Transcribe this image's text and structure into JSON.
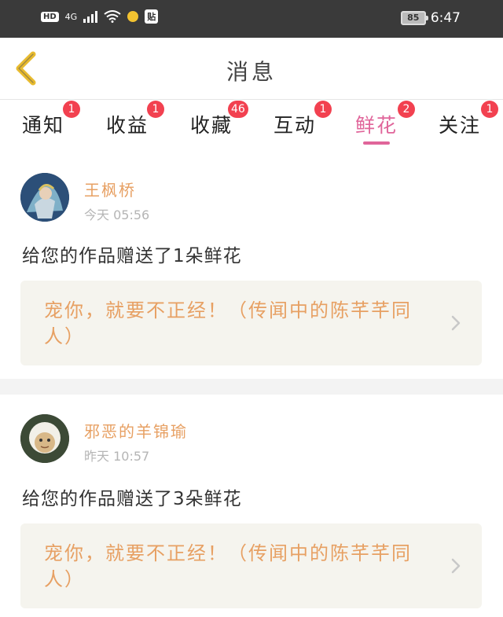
{
  "status_bar": {
    "hd": "HD",
    "network": "4G",
    "tie_label": "贴",
    "battery": "85",
    "time": "6:47"
  },
  "header": {
    "title": "消息",
    "back_icon": "chevron-left-icon",
    "back_color": "#e8bb2f"
  },
  "tabs": [
    {
      "label": "通知",
      "badge": "1",
      "active": false
    },
    {
      "label": "收益",
      "badge": "1",
      "active": false
    },
    {
      "label": "收藏",
      "badge": "46",
      "active": false
    },
    {
      "label": "互动",
      "badge": "1",
      "active": false
    },
    {
      "label": "鲜花",
      "badge": "2",
      "active": true
    },
    {
      "label": "关注",
      "badge": "1",
      "active": false
    }
  ],
  "colors": {
    "accent": "#e0659a",
    "badge": "#f24150",
    "name": "#e7a063",
    "card_bg": "#f5f4ee"
  },
  "notifications": [
    {
      "sender": "王枫桥",
      "time": "今天 05:56",
      "message": "给您的作品赠送了1朵鲜花",
      "work_title": "宠你，就要不正经！（传闻中的陈芊芊同人）"
    },
    {
      "sender": "邪恶的羊锦瑜",
      "time": "昨天 10:57",
      "message": "给您的作品赠送了3朵鲜花",
      "work_title": "宠你，就要不正经！（传闻中的陈芊芊同人）"
    }
  ]
}
